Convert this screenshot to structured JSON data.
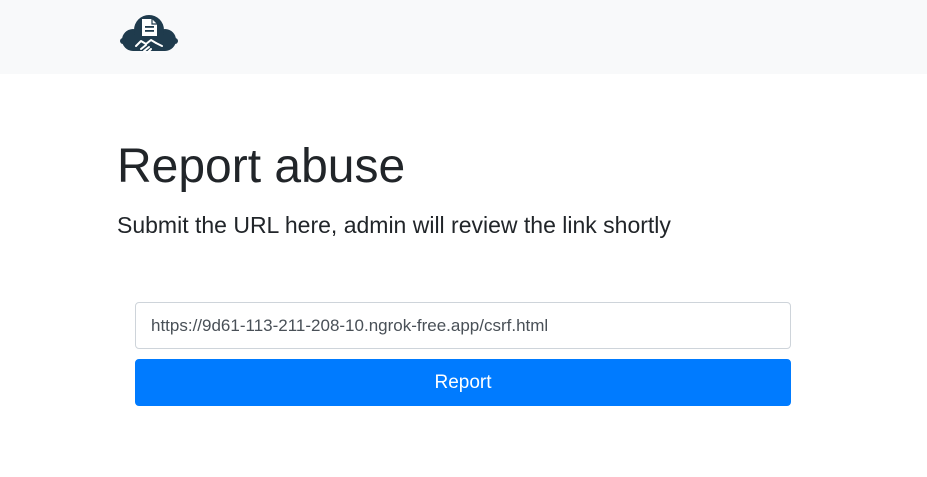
{
  "navbar": {
    "logo_icon": "handshake-cloud-logo-icon"
  },
  "main": {
    "title": "Report abuse",
    "lead": "Submit the URL here, admin will review the link shortly"
  },
  "form": {
    "url_value": "https://9d61-113-211-208-10.ngrok-free.app/csrf.html",
    "submit_label": "Report"
  },
  "colors": {
    "navbar_bg": "#f8f9fa",
    "primary": "#007bff",
    "logo": "#1f3b4d"
  }
}
